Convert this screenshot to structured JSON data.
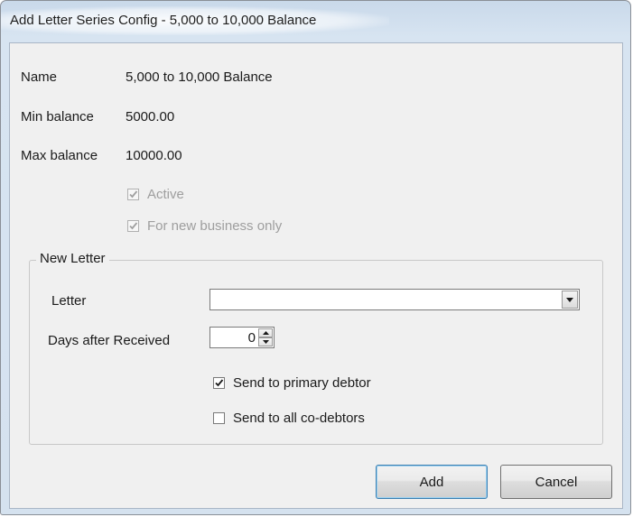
{
  "window": {
    "title": "Add Letter Series Config - 5,000 to 10,000 Balance"
  },
  "fields": {
    "name_label": "Name",
    "name_value": "5,000 to 10,000 Balance",
    "min_balance_label": "Min balance",
    "min_balance_value": "5000.00",
    "max_balance_label": "Max balance",
    "max_balance_value": "10000.00",
    "active_label": "Active",
    "active_checked": true,
    "active_enabled": false,
    "new_business_label": "For new business only",
    "new_business_checked": true,
    "new_business_enabled": false
  },
  "new_letter": {
    "group_title": "New Letter",
    "letter_label": "Letter",
    "letter_value": "",
    "days_label": "Days after Received",
    "days_value": "0",
    "send_primary_label": "Send to primary debtor",
    "send_primary_checked": true,
    "send_all_label": "Send to all co-debtors",
    "send_all_checked": false
  },
  "buttons": {
    "add_label": "Add",
    "cancel_label": "Cancel"
  }
}
